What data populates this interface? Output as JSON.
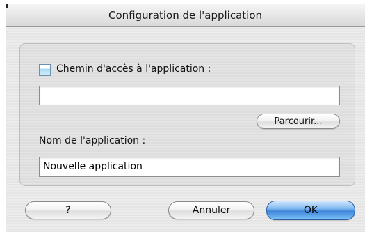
{
  "window": {
    "title": "Configuration de l'application"
  },
  "form": {
    "path_label": "Chemin d'accès à l'application :",
    "path_value": "",
    "browse_label": "Parcourir...",
    "name_label": "Nom de l'application :",
    "name_value": "Nouvelle application"
  },
  "buttons": {
    "help_label": "?",
    "cancel_label": "Annuler",
    "ok_label": "OK"
  },
  "colors": {
    "accent": "#3d86d8"
  },
  "icons": {
    "checkbox": "checkbox-icon"
  }
}
